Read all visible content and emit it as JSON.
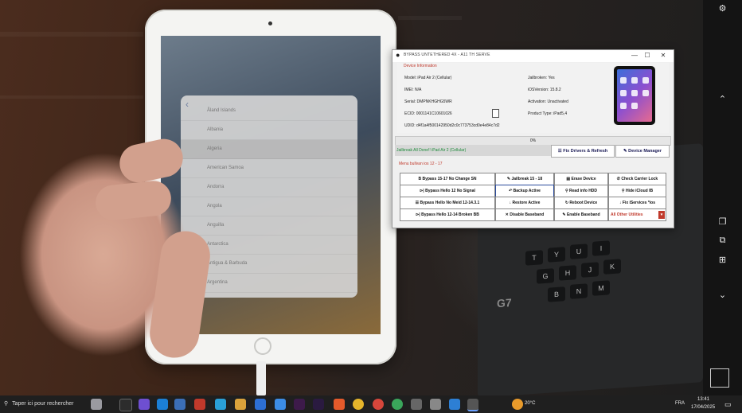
{
  "app": {
    "title": "BYPASS UNTETHERED 4X - A11 TH SERVE",
    "device_info_title": "Device Information",
    "model": "Model: iPad Air 2 (Cellular)",
    "imei": "IMEI: N/A",
    "serial": "Serial: DMPNKHGHG5WR",
    "ecid": "ECID: 0001141C10601026",
    "udid": "UDID: d4f1a4f500142950d2c0c773753cd0e4e84c7d2",
    "jailbroken": "Jailbroken: Yes",
    "ios_version": "iOSVersion: 15.8.2",
    "activation": "Activation: Unactivated",
    "product_type": "Product Type: iPad5,4",
    "progress_value": "0%",
    "status_text": "Jailbreak All Done!! iPad Air 2 (Cellular)",
    "fix_drivers_label": "Fix Drivers & Refresh",
    "device_manager_label": "Device Manager",
    "menu_title": "Menu bullvan ios 12 - 17",
    "buttons": [
      [
        "Bypass 15-17 No Change SN",
        "Jailbreak 15 - 18",
        "Erase Device",
        "Check Carrier Lock"
      ],
      [
        "Bypass Hello 12 No Signal",
        "Backup Active",
        "Read info HDD",
        "Hide iCloud IB"
      ],
      [
        "Bypass Hello No Meid 12-14.3.1",
        "Restore Active",
        "Reboot Device",
        "Fix iServices *ios"
      ],
      [
        "Bypass Hello 12-14 Broken BB",
        "Disable Baseband",
        "Enable Baseband",
        "All Other Utilities"
      ]
    ],
    "window_controls": [
      "—",
      "☐",
      "✕"
    ]
  },
  "ipad_countries": [
    "Åland Islands",
    "Albania",
    "Algeria",
    "American Samoa",
    "Andorra",
    "Angola",
    "Anguilla",
    "Antarctica",
    "Antigua & Barbuda",
    "Argentina"
  ],
  "taskbar": {
    "search_placeholder": "Taper ici pour rechercher",
    "weather": "20°C",
    "language": "FRA",
    "time": "13:41",
    "date": "17/04/2025"
  },
  "keyboard_keys": [
    "T",
    "Y",
    "U",
    "I",
    "G",
    "H",
    "J",
    "K",
    "B",
    "N",
    "M"
  ],
  "keyboard_logo": "G7",
  "colors": {
    "accent_red": "#c0392b",
    "status_green": "#1e8b3a",
    "button_text_blue": "#1a1a55"
  }
}
